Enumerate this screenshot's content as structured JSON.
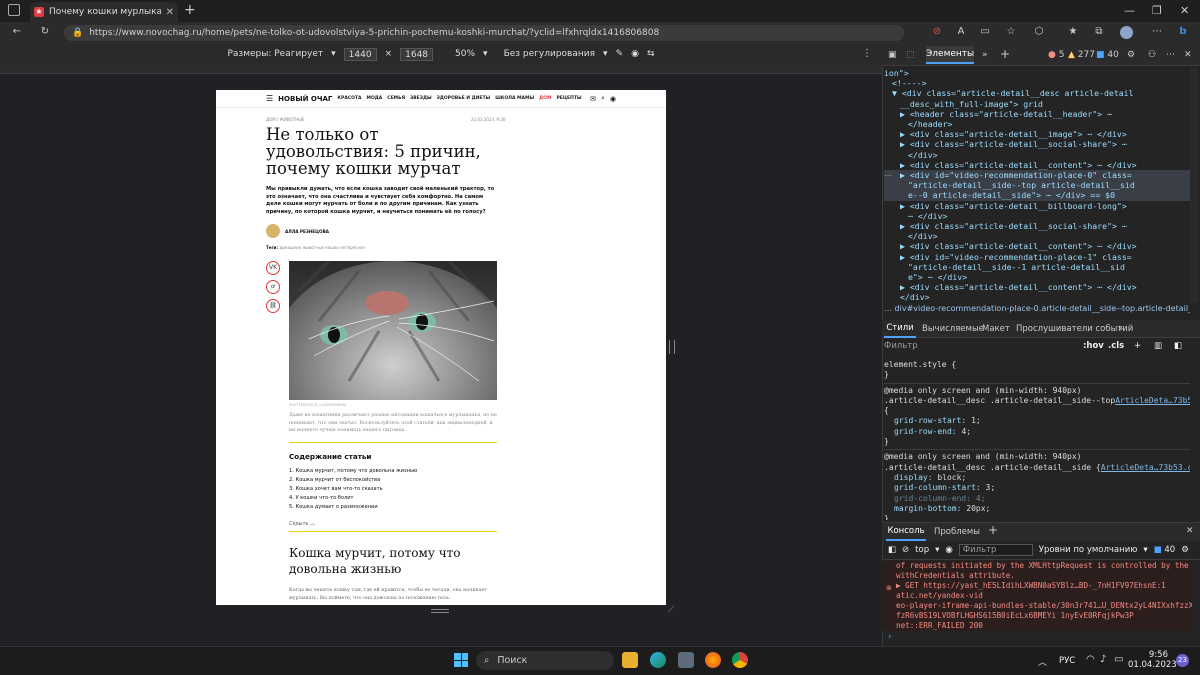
{
  "browser": {
    "tab_title": "Почему кошки мурлыкают — пя",
    "url": "https://www.novochag.ru/home/pets/ne-tolko-ot-udovolstviya-5-prichin-pochemu-koshki-murchat/?yclid=lfxhrqldx1416806808"
  },
  "device_toolbar": {
    "dimensions_label": "Размеры: Реагирует",
    "width": "1440",
    "height": "1648",
    "zoom": "50%",
    "throttling": "Без регулирования"
  },
  "site": {
    "logo": "НОВЫЙ ОЧАГ",
    "nav": [
      "КРАСОТА",
      "МОДА",
      "СЕМЬЯ",
      "ЗВЕЗДЫ",
      "ЗДОРОВЬЕ И ДИЕТЫ",
      "ШКОЛА МАМЫ",
      "ДОМ",
      "РЕЦЕПТЫ"
    ]
  },
  "article": {
    "breadcrumb": "ДОМ / ЖИВОТНЫЕ",
    "date": "22.03.2023, 9:30",
    "title": "Не только от удовольствия: 5 причин, почему кошки мурчат",
    "lead": "Мы привыкли думать, что если кошка заводит свой маленький трактор, то это означает, что она счастлива и чувствует себя комфортно. На самом деле кошки могут мурчать от боли и по другим причинам. Как узнать причину, по которой кошка мурчит, и научиться понимать её по голосу?",
    "author": "АЛЛА РЕЗНЕЦОВА",
    "tags_label": "Теги:",
    "tags": "домашние животные  кошки  интересное",
    "share": [
      "VK",
      "OK",
      "link"
    ],
    "photo_credit": "SHUTTERSTOCK / LEGION-MEDIA",
    "caption": "Даже не кошатники различают разные интонации кошачьего мурлыканья, но не понимают, что они значат. Воспользуйтесь этой статьёй, как энциклопедией, и вы начнете лучше понимать вашего питомца.",
    "toc_title": "Содержание статьи",
    "toc": [
      "1. Кошка мурчит, потому что довольна жизнью",
      "2. Кошка мурчит от беспокойства",
      "3. Кошка хочет вам что-то сказать",
      "4. У кошки что-то болит",
      "5. Кошка думает о размножении"
    ],
    "hide_label": "Скрыть",
    "section_title": "Кошка мурчит, потому что довольна жизнью",
    "section_text": "Когда вы чешете кошку там, где ей нравится, чтобы ее чесали, она начинает мурлыкать. Вы поймете, что она довольна по положению тела."
  },
  "devtools": {
    "tab_elements": "Элементы",
    "errors": "5",
    "warnings": "277",
    "info": "40",
    "dom_lines": [
      {
        "indent": 0,
        "html": "ion\">"
      },
      {
        "indent": 1,
        "html": "<!---->"
      },
      {
        "indent": 1,
        "html": "▼ <div class=\"article-detail__desc article-detail"
      },
      {
        "indent": 2,
        "html": "__desc_with_full-image\"> grid"
      },
      {
        "indent": 2,
        "html": "▶ <header class=\"article-detail__header\"> ⋯"
      },
      {
        "indent": 3,
        "html": "</header>"
      },
      {
        "indent": 2,
        "html": "▶ <div class=\"article-detail__image\"> ⋯ </div>"
      },
      {
        "indent": 2,
        "html": "▶ <div class=\"article-detail__social-share\"> ⋯"
      },
      {
        "indent": 3,
        "html": "</div>"
      },
      {
        "indent": 2,
        "html": "▶ <div class=\"article-detail__content\"> ⋯ </div>"
      },
      {
        "indent": 2,
        "html": "▶ <div id=\"video-recommendation-place-0\" class="
      },
      {
        "indent": 3,
        "html": "\"article-detail__side--top article-detail__sid"
      },
      {
        "indent": 3,
        "html": "e--0 article-detail__side\"> ⋯ </div> == $0"
      },
      {
        "indent": 2,
        "html": "▶ <div class=\"article-detail__billboard-long\">"
      },
      {
        "indent": 3,
        "html": "⋯ </div>"
      },
      {
        "indent": 2,
        "html": "▶ <div class=\"article-detail__social-share\"> ⋯"
      },
      {
        "indent": 3,
        "html": "</div>"
      },
      {
        "indent": 2,
        "html": "▶ <div class=\"article-detail__content\"> ⋯ </div>"
      },
      {
        "indent": 2,
        "html": "▶ <div id=\"video-recommendation-place-1\" class="
      },
      {
        "indent": 3,
        "html": "\"article-detail__side--1 article-detail__sid"
      },
      {
        "indent": 3,
        "html": "e\"> ⋯ </div>"
      },
      {
        "indent": 2,
        "html": "▶ <div class=\"article-detail__content\"> ⋯ </div>"
      },
      {
        "indent": 2,
        "html": "</div>"
      }
    ],
    "breadcrumb": "div#video-recommendation-place-0.article-detail__side--top.article-detail__side--0.a",
    "style_tabs": [
      "Стили",
      "Вычисляемые",
      "Макет",
      "Прослушиватели событий"
    ],
    "filter_placeholder": "Фильтр",
    "hov": ":hov",
    "cls": ".cls",
    "styles": [
      {
        "t": "sel",
        "s": "element.style {"
      },
      {
        "t": "plain",
        "s": "}"
      },
      {
        "t": "sep",
        "s": ""
      },
      {
        "t": "sel",
        "s": "@media only screen and (min-width: 940px)"
      },
      {
        "t": "rule",
        "s": ".article-detail__desc .article-detail__side--top",
        "link": "ArticleDeta…73b53.css:1"
      },
      {
        "t": "plain",
        "s": "{"
      },
      {
        "t": "prop",
        "s": "grid-row-start: 1;"
      },
      {
        "t": "prop",
        "s": "grid-row-end: 4;"
      },
      {
        "t": "plain",
        "s": "}"
      },
      {
        "t": "sep",
        "s": ""
      },
      {
        "t": "sel",
        "s": "@media only screen and (min-width: 940px)"
      },
      {
        "t": "rule",
        "s": ".article-detail__desc .article-detail__side {",
        "link": "ArticleDeta…73b53.css:1"
      },
      {
        "t": "prop",
        "s": "display: block;"
      },
      {
        "t": "prop",
        "s": "grid-column-start: 3;"
      },
      {
        "t": "dim",
        "s": "grid-column-end: 4;"
      },
      {
        "t": "prop",
        "s": "margin-bottom: 20px;"
      },
      {
        "t": "plain",
        "s": "}"
      }
    ],
    "console_tab": "Консоль",
    "problems_tab": "Проблемы",
    "context": "top",
    "console_filter": "Фильтр",
    "levels": "Уровни по умолчанию",
    "issues": "40",
    "console_lines": [
      "of requests initiated by the XMLHttpRequest is controlled by the",
      "withCredentials attribute.",
      "▶ GET https://yast_hE5LIdihLXWBN0aSYBlz…BD-_7nH1FV97EhsnE:1",
      "atic.net/yandex-vid",
      "eo-player-iframe-api-bundles-stable/30n3r741…U_DENtx2yL4NIXxhfzzX-E",
      "fzR6vBS19LVOBfLHGHS615B0iEcLx6BMEYi 1nyEvE0RFqjkPw3P",
      "net::ERR_FAILED 200"
    ]
  },
  "taskbar": {
    "search": "Поиск",
    "lang": "РУС",
    "time": "9:56",
    "date": "01.04.2023",
    "notifications": "23"
  }
}
